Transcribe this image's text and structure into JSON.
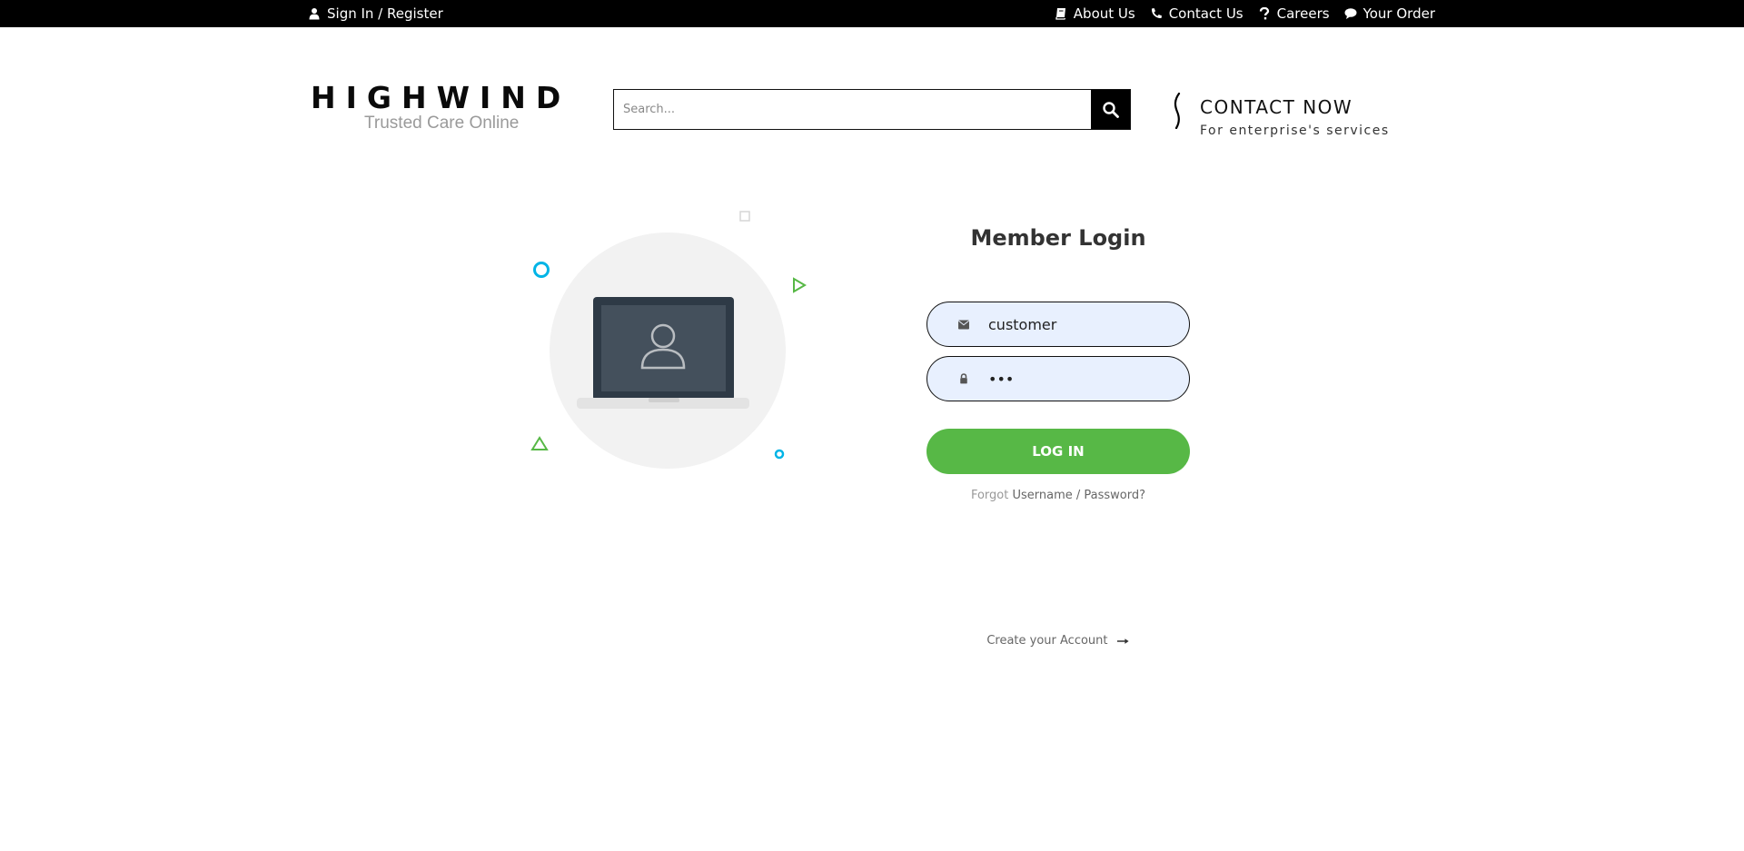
{
  "topbar": {
    "signin_label": "Sign In / Register",
    "nav": [
      {
        "label": "About Us",
        "icon": "book-icon"
      },
      {
        "label": "Contact Us",
        "icon": "phone-icon"
      },
      {
        "label": "Careers",
        "icon": "question-icon"
      },
      {
        "label": "Your Order",
        "icon": "comment-icon"
      }
    ]
  },
  "header": {
    "brand": "HIGHWIND",
    "tagline": "Trusted Care Online",
    "search_placeholder": "Search...",
    "contact_title": "CONTACT NOW",
    "contact_subtitle": "For enterprise's services"
  },
  "login": {
    "title": "Member Login",
    "username_value": "customer",
    "password_value": "•••",
    "button_label": "LOG IN",
    "forgot_prefix": "Forgot",
    "forgot_link": "Username / Password?",
    "create_account": "Create your Account"
  },
  "colors": {
    "accent_green": "#57b846",
    "input_bg": "#e8f0fe",
    "topbar_bg": "#000000",
    "deco_blue": "#00b4e6"
  }
}
